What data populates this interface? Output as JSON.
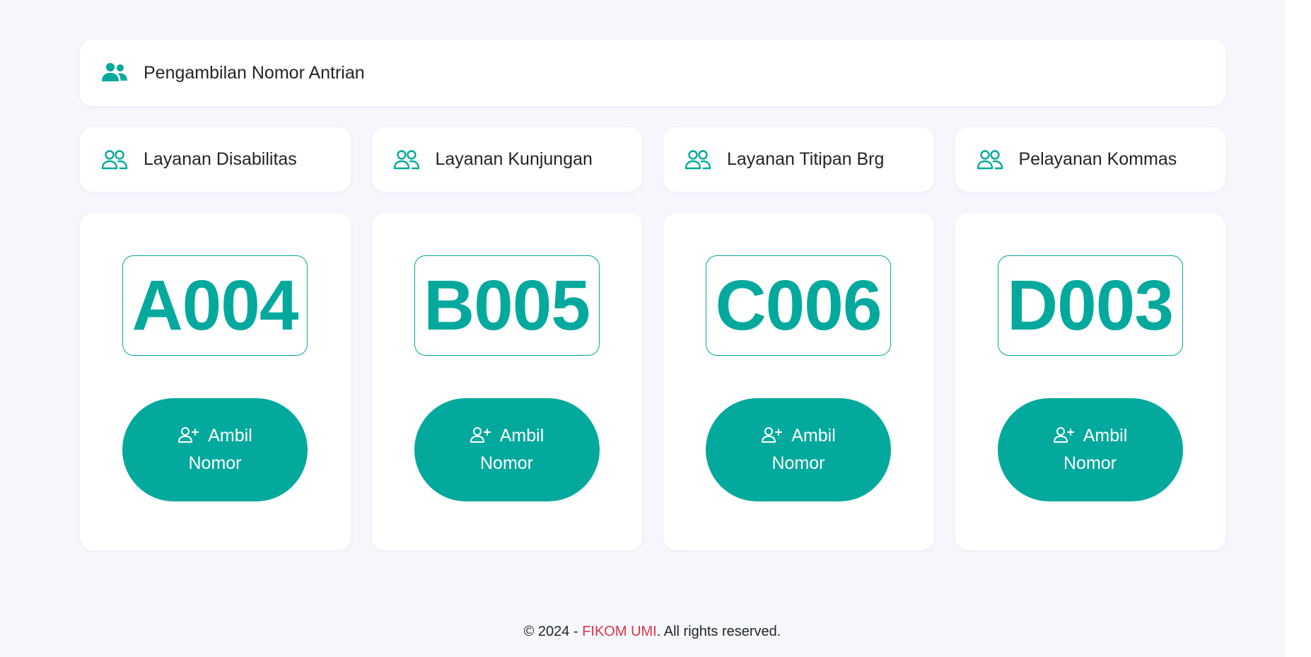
{
  "header": {
    "title": "Pengambilan Nomor Antrian",
    "icon": "users-solid-icon"
  },
  "services": [
    {
      "label": "Layanan Disabilitas",
      "icon": "users-outline-icon"
    },
    {
      "label": "Layanan Kunjungan",
      "icon": "users-outline-icon"
    },
    {
      "label": "Layanan Titipan Brg",
      "icon": "users-outline-icon"
    },
    {
      "label": "Pelayanan Kommas",
      "icon": "users-outline-icon"
    }
  ],
  "queues": [
    {
      "number": "A004",
      "button_line1": "Ambil",
      "button_line2": "Nomor"
    },
    {
      "number": "B005",
      "button_line1": "Ambil",
      "button_line2": "Nomor"
    },
    {
      "number": "C006",
      "button_line1": "Ambil",
      "button_line2": "Nomor"
    },
    {
      "number": "D003",
      "button_line1": "Ambil",
      "button_line2": "Nomor"
    }
  ],
  "footer": {
    "prefix": "© 2024 - ",
    "brand": "FIKOM UMI",
    "suffix": ". All rights reserved."
  },
  "colors": {
    "accent": "#04a99d",
    "brand_red": "#dc3545",
    "background": "#f5f7fc",
    "card": "#ffffff"
  }
}
